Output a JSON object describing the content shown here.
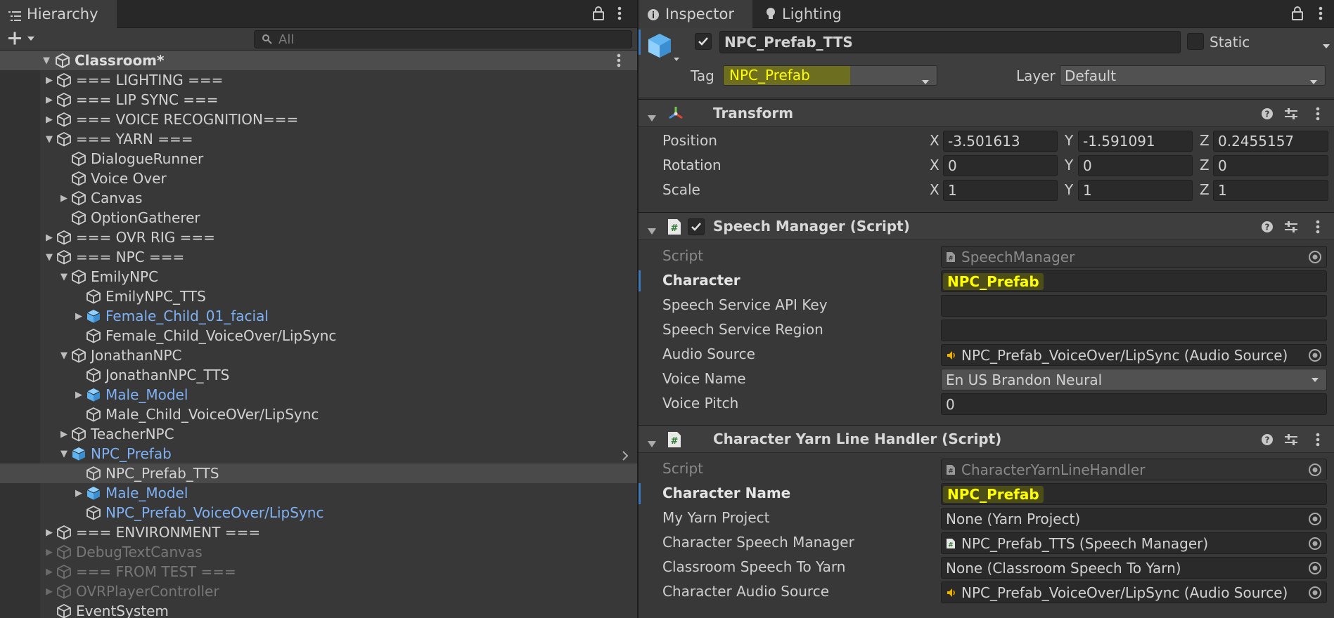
{
  "hierarchy": {
    "tab_label": "Hierarchy",
    "search_placeholder": "All",
    "scene_name": "Classroom*",
    "items": [
      {
        "label": "=== LIGHTING ===",
        "depth": 0,
        "arrow": "right",
        "icon": "cube",
        "style": "normal"
      },
      {
        "label": "=== LIP SYNC ===",
        "depth": 0,
        "arrow": "right",
        "icon": "cube",
        "style": "normal"
      },
      {
        "label": "=== VOICE RECOGNITION===",
        "depth": 0,
        "arrow": "right",
        "icon": "cube",
        "style": "normal"
      },
      {
        "label": "=== YARN ===",
        "depth": 0,
        "arrow": "down",
        "icon": "cube",
        "style": "normal"
      },
      {
        "label": "DialogueRunner",
        "depth": 1,
        "arrow": "",
        "icon": "cube",
        "style": "normal"
      },
      {
        "label": "Voice Over",
        "depth": 1,
        "arrow": "",
        "icon": "cube",
        "style": "normal"
      },
      {
        "label": "Canvas",
        "depth": 1,
        "arrow": "right",
        "icon": "cube",
        "style": "normal"
      },
      {
        "label": "OptionGatherer",
        "depth": 1,
        "arrow": "",
        "icon": "cube",
        "style": "normal"
      },
      {
        "label": "=== OVR RIG ===",
        "depth": 0,
        "arrow": "right",
        "icon": "cube",
        "style": "normal"
      },
      {
        "label": "=== NPC ===",
        "depth": 0,
        "arrow": "down",
        "icon": "cube",
        "style": "normal"
      },
      {
        "label": "EmilyNPC",
        "depth": 1,
        "arrow": "down",
        "icon": "cube",
        "style": "normal"
      },
      {
        "label": "EmilyNPC_TTS",
        "depth": 2,
        "arrow": "",
        "icon": "cube",
        "style": "normal"
      },
      {
        "label": "Female_Child_01_facial",
        "depth": 2,
        "arrow": "right",
        "icon": "prefab",
        "style": "blue"
      },
      {
        "label": "Female_Child_VoiceOver/LipSync",
        "depth": 2,
        "arrow": "",
        "icon": "cube",
        "style": "normal"
      },
      {
        "label": "JonathanNPC",
        "depth": 1,
        "arrow": "down",
        "icon": "cube",
        "style": "normal"
      },
      {
        "label": "JonathanNPC_TTS",
        "depth": 2,
        "arrow": "",
        "icon": "cube",
        "style": "normal"
      },
      {
        "label": "Male_Model",
        "depth": 2,
        "arrow": "right",
        "icon": "prefab",
        "style": "blue"
      },
      {
        "label": "Male_Child_VoiceOVer/LipSync",
        "depth": 2,
        "arrow": "",
        "icon": "cube",
        "style": "normal"
      },
      {
        "label": "TeacherNPC",
        "depth": 1,
        "arrow": "right",
        "icon": "cube",
        "style": "normal"
      },
      {
        "label": "NPC_Prefab",
        "depth": 1,
        "arrow": "down",
        "icon": "prefab-solid",
        "style": "blue"
      },
      {
        "label": "NPC_Prefab_TTS",
        "depth": 2,
        "arrow": "",
        "icon": "cube",
        "style": "selected"
      },
      {
        "label": "Male_Model",
        "depth": 2,
        "arrow": "right",
        "icon": "prefab",
        "style": "blue"
      },
      {
        "label": "NPC_Prefab_VoiceOver/LipSync",
        "depth": 2,
        "arrow": "",
        "icon": "cube",
        "style": "blue"
      },
      {
        "label": "=== ENVIRONMENT ===",
        "depth": 0,
        "arrow": "right",
        "icon": "cube",
        "style": "normal"
      },
      {
        "label": "DebugTextCanvas",
        "depth": 0,
        "arrow": "right",
        "icon": "cube",
        "style": "dim"
      },
      {
        "label": "=== FROM TEST ===",
        "depth": 0,
        "arrow": "right",
        "icon": "cube",
        "style": "dim"
      },
      {
        "label": "OVRPlayerController",
        "depth": 0,
        "arrow": "right",
        "icon": "cube",
        "style": "dim"
      },
      {
        "label": "EventSystem",
        "depth": 0,
        "arrow": "",
        "icon": "cube",
        "style": "normal"
      }
    ]
  },
  "inspector": {
    "tab_label": "Inspector",
    "lighting_tab_label": "Lighting",
    "object_name": "NPC_Prefab_TTS",
    "static_label": "Static",
    "tag_label": "Tag",
    "tag_value": "NPC_Prefab",
    "layer_label": "Layer",
    "layer_value": "Default",
    "transform": {
      "title": "Transform",
      "position_label": "Position",
      "rotation_label": "Rotation",
      "scale_label": "Scale",
      "position": {
        "x": "-3.501613",
        "y": "-1.591091",
        "z": "0.2455157"
      },
      "rotation": {
        "x": "0",
        "y": "0",
        "z": "0"
      },
      "scale": {
        "x": "1",
        "y": "1",
        "z": "1"
      },
      "axis_x": "X",
      "axis_y": "Y",
      "axis_z": "Z"
    },
    "speech_manager": {
      "title": "Speech Manager (Script)",
      "script_label": "Script",
      "script_value": "SpeechManager",
      "character_label": "Character",
      "character_value": "NPC_Prefab",
      "api_key_label": "Speech Service API Key",
      "api_key_value": "",
      "region_label": "Speech Service Region",
      "region_value": "",
      "audio_source_label": "Audio Source",
      "audio_source_value": "NPC_Prefab_VoiceOver/LipSync (Audio Source)",
      "voice_name_label": "Voice Name",
      "voice_name_value": "En US Brandon Neural",
      "voice_pitch_label": "Voice Pitch",
      "voice_pitch_value": "0"
    },
    "yarn_handler": {
      "title": "Character Yarn Line Handler (Script)",
      "script_label": "Script",
      "script_value": "CharacterYarnLineHandler",
      "character_name_label": "Character Name",
      "character_name_value": "NPC_Prefab",
      "yarn_project_label": "My Yarn Project",
      "yarn_project_value": "None (Yarn Project)",
      "speech_manager_label": "Character Speech Manager",
      "speech_manager_value": "NPC_Prefab_TTS (Speech Manager)",
      "classroom_label": "Classroom Speech To Yarn",
      "classroom_value": "None (Classroom Speech To Yarn)",
      "audio_source_label": "Character Audio Source",
      "audio_source_value": "NPC_Prefab_VoiceOver/LipSync (Audio Source)"
    }
  }
}
